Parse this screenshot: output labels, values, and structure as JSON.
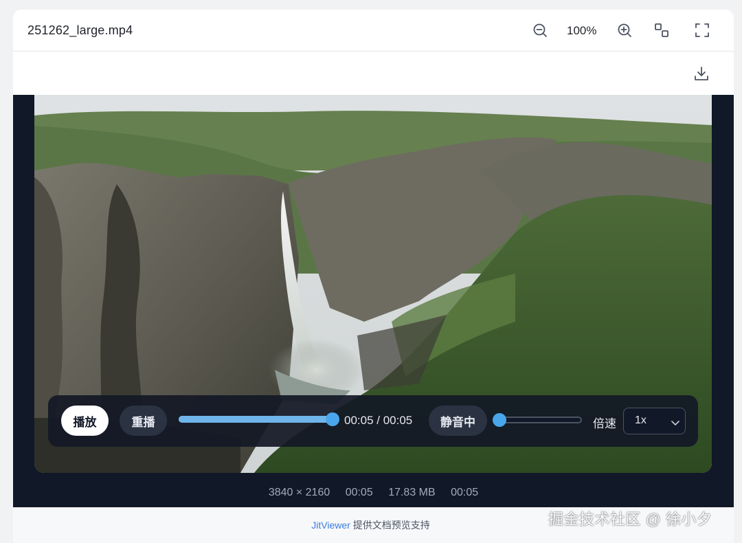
{
  "titlebar": {
    "file_name": "251262_large.mp4",
    "zoom_level": "100%",
    "icons": [
      "zoom-out-icon",
      "zoom-in-icon",
      "fit-window-icon",
      "fullscreen-icon"
    ]
  },
  "toolbar": {
    "icons": [
      "download-icon"
    ]
  },
  "player": {
    "play_label": "播放",
    "replay_label": "重播",
    "progress_fraction": 1.0,
    "time_text": "00:05 / 00:05",
    "mute_label": "静音中",
    "volume_fraction": 0.0,
    "speed_label": "倍速",
    "speed_value": "1x",
    "accent_color": "#4aa6ea"
  },
  "meta": {
    "resolution": "3840 × 2160",
    "duration": "00:05",
    "file_size": "17.83 MB",
    "current_time": "00:05"
  },
  "footer": {
    "brand": "JitViewer",
    "text": " 提供文档预览支持"
  },
  "watermark": "掘金技术社区 @ 徐小夕"
}
